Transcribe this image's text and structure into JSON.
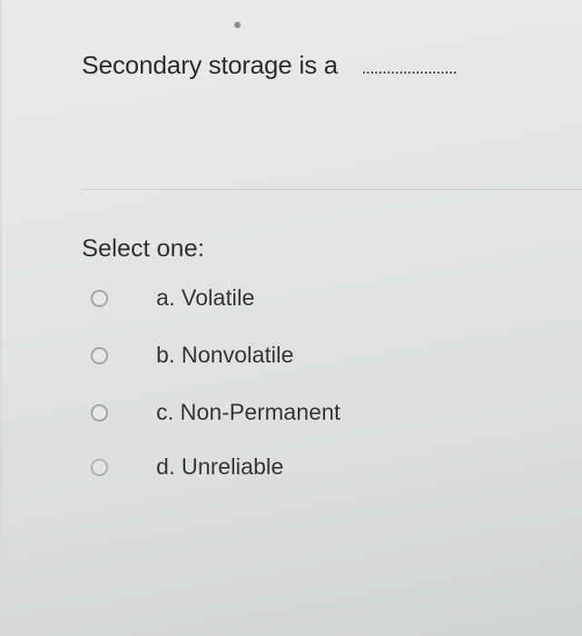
{
  "question": {
    "text": "Secondary storage is a",
    "blank": "......................."
  },
  "select_label": "Select one:",
  "options": [
    {
      "label": "a. Volatile",
      "selected": false
    },
    {
      "label": "b. Nonvolatile",
      "selected": false
    },
    {
      "label": "c. Non-Permanent",
      "selected": false
    },
    {
      "label": "d. Unreliable",
      "selected": false
    }
  ],
  "colors": {
    "background": "#e3e6e3",
    "text": "#2c2c2c",
    "radio_border": "#9ea39f"
  }
}
